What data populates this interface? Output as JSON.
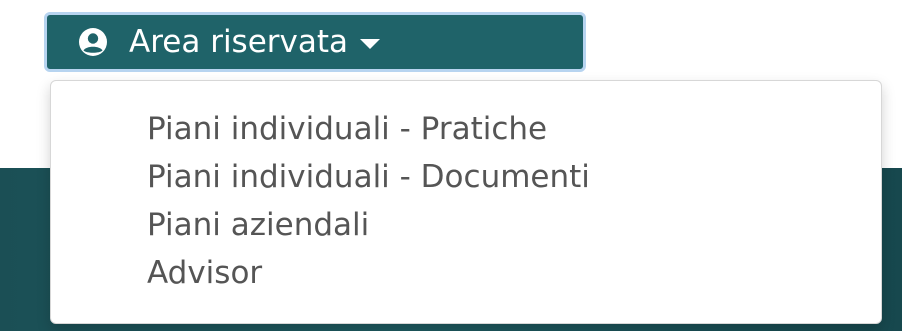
{
  "dropdown": {
    "label": "Area riservata",
    "icon": "user-circle-icon",
    "caret_icon": "caret-down-icon",
    "expanded": true
  },
  "menu": {
    "items": [
      {
        "label": "Piani individuali - Pratiche"
      },
      {
        "label": "Piani individuali - Documenti"
      },
      {
        "label": "Piani aziendali"
      },
      {
        "label": "Advisor"
      }
    ]
  },
  "colors": {
    "button_bg": "#1f6369",
    "button_focus_ring": "#b7d4f0",
    "button_text": "#ffffff",
    "menu_bg": "#ffffff",
    "menu_text": "#555555",
    "page_band": "#1b4f55"
  }
}
